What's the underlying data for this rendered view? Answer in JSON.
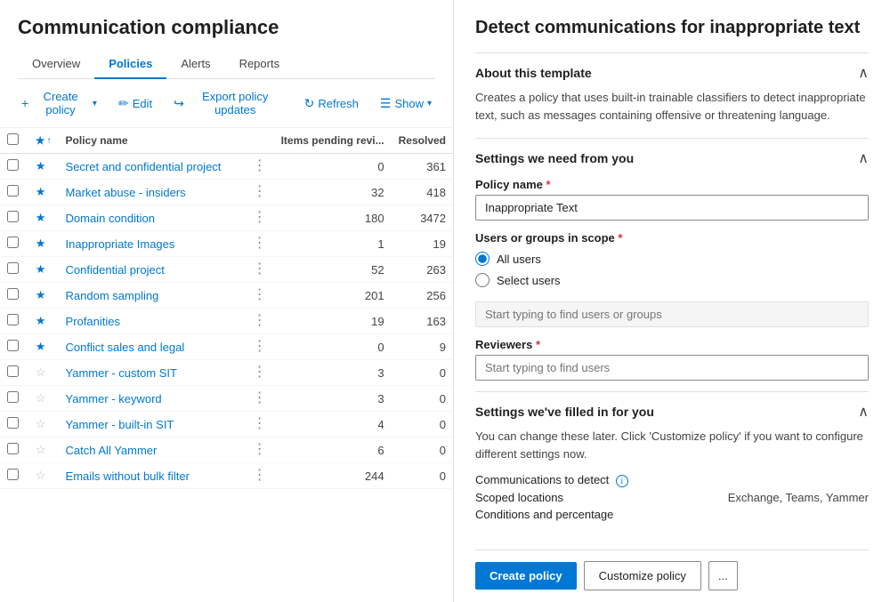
{
  "app": {
    "title": "Communication compliance"
  },
  "nav": {
    "tabs": [
      {
        "id": "overview",
        "label": "Overview",
        "active": false
      },
      {
        "id": "policies",
        "label": "Policies",
        "active": true
      },
      {
        "id": "alerts",
        "label": "Alerts",
        "active": false
      },
      {
        "id": "reports",
        "label": "Reports",
        "active": false
      }
    ]
  },
  "toolbar": {
    "create_label": "Create policy",
    "edit_label": "Edit",
    "export_label": "Export policy updates",
    "refresh_label": "Refresh",
    "show_label": "Show"
  },
  "table": {
    "col_star": "★↑",
    "col_name": "Policy name",
    "col_items": "Items pending revi...",
    "col_resolved": "Resolved",
    "rows": [
      {
        "name": "Secret and confidential project",
        "starred": true,
        "items_pending": "0",
        "resolved": "361"
      },
      {
        "name": "Market abuse - insiders",
        "starred": true,
        "items_pending": "32",
        "resolved": "418"
      },
      {
        "name": "Domain condition",
        "starred": true,
        "items_pending": "180",
        "resolved": "3472"
      },
      {
        "name": "Inappropriate Images",
        "starred": true,
        "items_pending": "1",
        "resolved": "19"
      },
      {
        "name": "Confidential project",
        "starred": true,
        "items_pending": "52",
        "resolved": "263"
      },
      {
        "name": "Random sampling",
        "starred": true,
        "items_pending": "201",
        "resolved": "256"
      },
      {
        "name": "Profanities",
        "starred": true,
        "items_pending": "19",
        "resolved": "163"
      },
      {
        "name": "Conflict sales and legal",
        "starred": true,
        "items_pending": "0",
        "resolved": "9"
      },
      {
        "name": "Yammer - custom SIT",
        "starred": false,
        "items_pending": "3",
        "resolved": "0"
      },
      {
        "name": "Yammer - keyword",
        "starred": false,
        "items_pending": "3",
        "resolved": "0"
      },
      {
        "name": "Yammer - built-in SIT",
        "starred": false,
        "items_pending": "4",
        "resolved": "0"
      },
      {
        "name": "Catch All Yammer",
        "starred": false,
        "items_pending": "6",
        "resolved": "0"
      },
      {
        "name": "Emails without bulk filter",
        "starred": false,
        "items_pending": "244",
        "resolved": "0"
      }
    ]
  },
  "right_panel": {
    "title": "Detect communications for inappropriate text",
    "section_about": {
      "heading": "About this template",
      "description": "Creates a policy that uses built-in trainable classifiers to detect inappropriate text, such as messages containing offensive or threatening language."
    },
    "section_settings": {
      "heading": "Settings we need from you",
      "policy_name_label": "Policy name",
      "policy_name_value": "Inappropriate Text",
      "users_label": "Users or groups in scope",
      "radio_all": "All users",
      "radio_select": "Select users",
      "users_placeholder": "Start typing to find users or groups",
      "reviewers_label": "Reviewers",
      "reviewers_placeholder": "Start typing to find users"
    },
    "section_filled": {
      "heading": "Settings we've filled in for you",
      "description": "You can change these later. Click 'Customize policy' if you want to configure different settings now.",
      "comms_label": "Communications to detect",
      "info_icon": "i",
      "locations_label": "Scoped locations",
      "locations_value": "Exchange, Teams, Yammer",
      "conditions_label": "Conditions and percentage"
    },
    "buttons": {
      "create": "Create policy",
      "customize": "Customize policy",
      "more": "..."
    }
  }
}
